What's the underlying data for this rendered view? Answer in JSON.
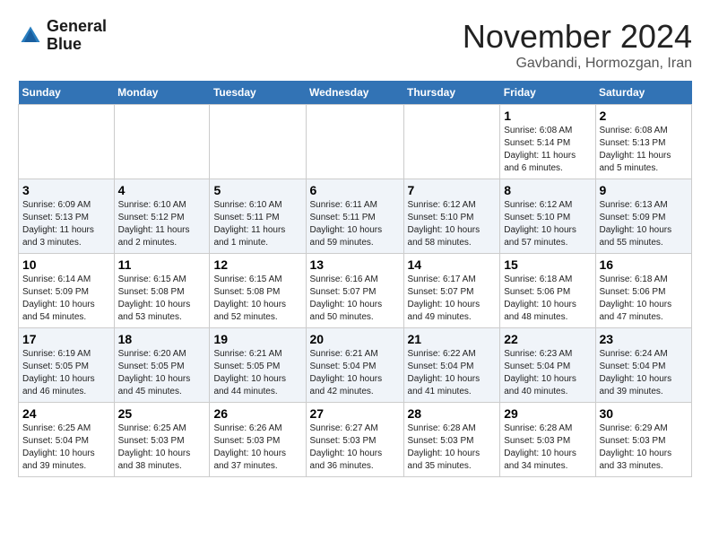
{
  "header": {
    "logo_line1": "General",
    "logo_line2": "Blue",
    "month": "November 2024",
    "location": "Gavbandi, Hormozgan, Iran"
  },
  "weekdays": [
    "Sunday",
    "Monday",
    "Tuesday",
    "Wednesday",
    "Thursday",
    "Friday",
    "Saturday"
  ],
  "weeks": [
    [
      {
        "day": "",
        "info": ""
      },
      {
        "day": "",
        "info": ""
      },
      {
        "day": "",
        "info": ""
      },
      {
        "day": "",
        "info": ""
      },
      {
        "day": "",
        "info": ""
      },
      {
        "day": "1",
        "info": "Sunrise: 6:08 AM\nSunset: 5:14 PM\nDaylight: 11 hours\nand 6 minutes."
      },
      {
        "day": "2",
        "info": "Sunrise: 6:08 AM\nSunset: 5:13 PM\nDaylight: 11 hours\nand 5 minutes."
      }
    ],
    [
      {
        "day": "3",
        "info": "Sunrise: 6:09 AM\nSunset: 5:13 PM\nDaylight: 11 hours\nand 3 minutes."
      },
      {
        "day": "4",
        "info": "Sunrise: 6:10 AM\nSunset: 5:12 PM\nDaylight: 11 hours\nand 2 minutes."
      },
      {
        "day": "5",
        "info": "Sunrise: 6:10 AM\nSunset: 5:11 PM\nDaylight: 11 hours\nand 1 minute."
      },
      {
        "day": "6",
        "info": "Sunrise: 6:11 AM\nSunset: 5:11 PM\nDaylight: 10 hours\nand 59 minutes."
      },
      {
        "day": "7",
        "info": "Sunrise: 6:12 AM\nSunset: 5:10 PM\nDaylight: 10 hours\nand 58 minutes."
      },
      {
        "day": "8",
        "info": "Sunrise: 6:12 AM\nSunset: 5:10 PM\nDaylight: 10 hours\nand 57 minutes."
      },
      {
        "day": "9",
        "info": "Sunrise: 6:13 AM\nSunset: 5:09 PM\nDaylight: 10 hours\nand 55 minutes."
      }
    ],
    [
      {
        "day": "10",
        "info": "Sunrise: 6:14 AM\nSunset: 5:09 PM\nDaylight: 10 hours\nand 54 minutes."
      },
      {
        "day": "11",
        "info": "Sunrise: 6:15 AM\nSunset: 5:08 PM\nDaylight: 10 hours\nand 53 minutes."
      },
      {
        "day": "12",
        "info": "Sunrise: 6:15 AM\nSunset: 5:08 PM\nDaylight: 10 hours\nand 52 minutes."
      },
      {
        "day": "13",
        "info": "Sunrise: 6:16 AM\nSunset: 5:07 PM\nDaylight: 10 hours\nand 50 minutes."
      },
      {
        "day": "14",
        "info": "Sunrise: 6:17 AM\nSunset: 5:07 PM\nDaylight: 10 hours\nand 49 minutes."
      },
      {
        "day": "15",
        "info": "Sunrise: 6:18 AM\nSunset: 5:06 PM\nDaylight: 10 hours\nand 48 minutes."
      },
      {
        "day": "16",
        "info": "Sunrise: 6:18 AM\nSunset: 5:06 PM\nDaylight: 10 hours\nand 47 minutes."
      }
    ],
    [
      {
        "day": "17",
        "info": "Sunrise: 6:19 AM\nSunset: 5:05 PM\nDaylight: 10 hours\nand 46 minutes."
      },
      {
        "day": "18",
        "info": "Sunrise: 6:20 AM\nSunset: 5:05 PM\nDaylight: 10 hours\nand 45 minutes."
      },
      {
        "day": "19",
        "info": "Sunrise: 6:21 AM\nSunset: 5:05 PM\nDaylight: 10 hours\nand 44 minutes."
      },
      {
        "day": "20",
        "info": "Sunrise: 6:21 AM\nSunset: 5:04 PM\nDaylight: 10 hours\nand 42 minutes."
      },
      {
        "day": "21",
        "info": "Sunrise: 6:22 AM\nSunset: 5:04 PM\nDaylight: 10 hours\nand 41 minutes."
      },
      {
        "day": "22",
        "info": "Sunrise: 6:23 AM\nSunset: 5:04 PM\nDaylight: 10 hours\nand 40 minutes."
      },
      {
        "day": "23",
        "info": "Sunrise: 6:24 AM\nSunset: 5:04 PM\nDaylight: 10 hours\nand 39 minutes."
      }
    ],
    [
      {
        "day": "24",
        "info": "Sunrise: 6:25 AM\nSunset: 5:04 PM\nDaylight: 10 hours\nand 39 minutes."
      },
      {
        "day": "25",
        "info": "Sunrise: 6:25 AM\nSunset: 5:03 PM\nDaylight: 10 hours\nand 38 minutes."
      },
      {
        "day": "26",
        "info": "Sunrise: 6:26 AM\nSunset: 5:03 PM\nDaylight: 10 hours\nand 37 minutes."
      },
      {
        "day": "27",
        "info": "Sunrise: 6:27 AM\nSunset: 5:03 PM\nDaylight: 10 hours\nand 36 minutes."
      },
      {
        "day": "28",
        "info": "Sunrise: 6:28 AM\nSunset: 5:03 PM\nDaylight: 10 hours\nand 35 minutes."
      },
      {
        "day": "29",
        "info": "Sunrise: 6:28 AM\nSunset: 5:03 PM\nDaylight: 10 hours\nand 34 minutes."
      },
      {
        "day": "30",
        "info": "Sunrise: 6:29 AM\nSunset: 5:03 PM\nDaylight: 10 hours\nand 33 minutes."
      }
    ]
  ]
}
